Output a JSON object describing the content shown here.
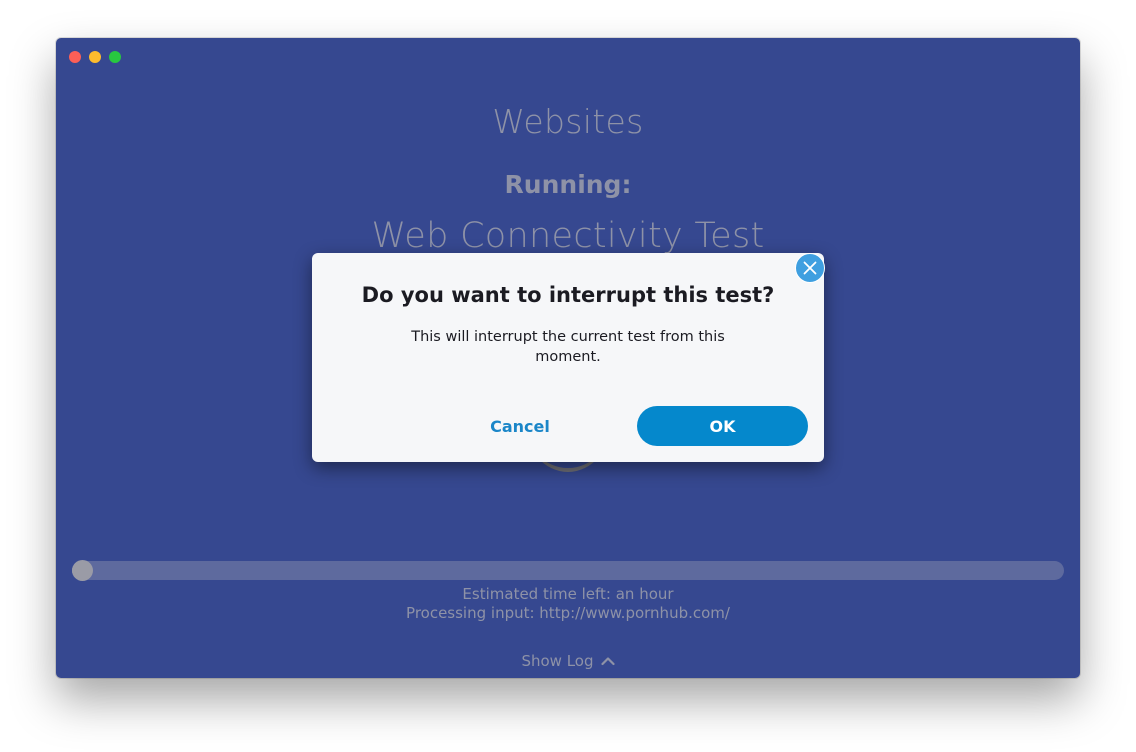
{
  "window": {
    "title": "Websites",
    "running_label": "Running:",
    "test_name": "Web Connectivity Test"
  },
  "progress": {
    "fraction": 0.0,
    "eta_text": "Estimated time left: an hour",
    "processing_text": "Processing input: http://www.pornhub.com/"
  },
  "log": {
    "toggle_label": "Show Log",
    "icon": "chevron-up-icon"
  },
  "dialog": {
    "title": "Do you want to interrupt this test?",
    "body": "This will interrupt the current test from this moment.",
    "cancel_label": "Cancel",
    "ok_label": "OK",
    "close_icon": "close-icon"
  },
  "colors": {
    "background": "#364890",
    "muted_text": "#8e92a7",
    "accent": "#0588cc",
    "close_button": "#3f9fe0"
  }
}
